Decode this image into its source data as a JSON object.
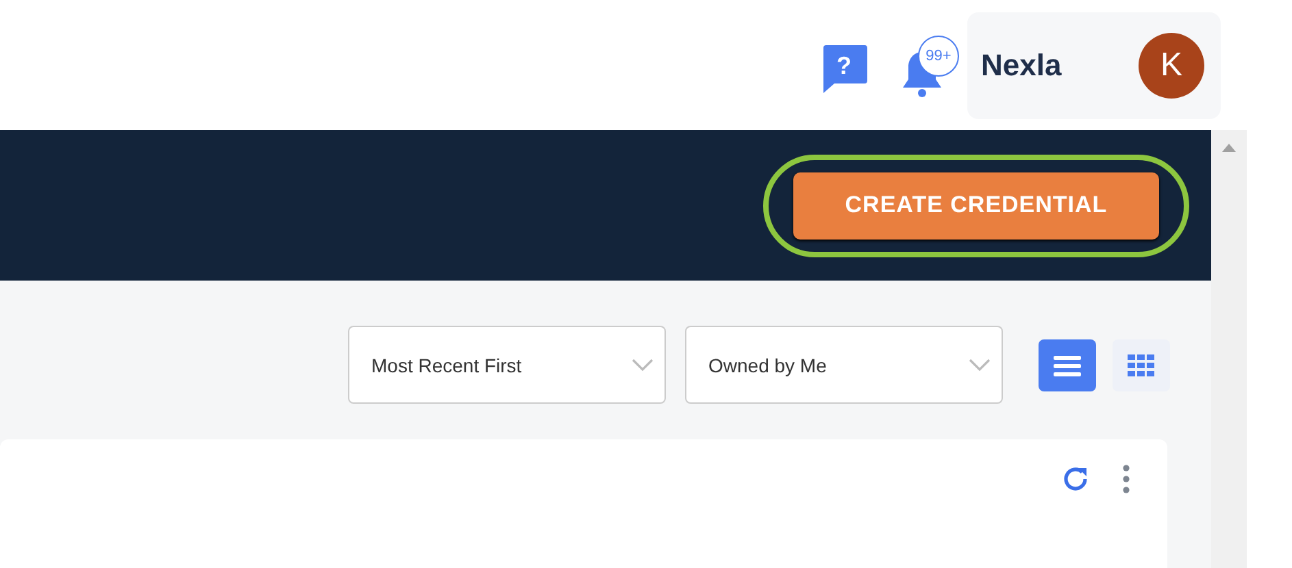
{
  "header": {
    "help_glyph": "?",
    "notification_badge": "99+",
    "user": {
      "name": "Nexla",
      "avatar_initial": "K"
    }
  },
  "banner": {
    "primary_button": {
      "label": "CREATE CREDENTIAL",
      "highlighted": true
    }
  },
  "filters": [
    {
      "value": "Most Recent First"
    },
    {
      "value": "Owned by Me"
    }
  ],
  "view_toggles": [
    {
      "kind": "list",
      "selected": true
    },
    {
      "kind": "grid",
      "selected": false
    }
  ]
}
